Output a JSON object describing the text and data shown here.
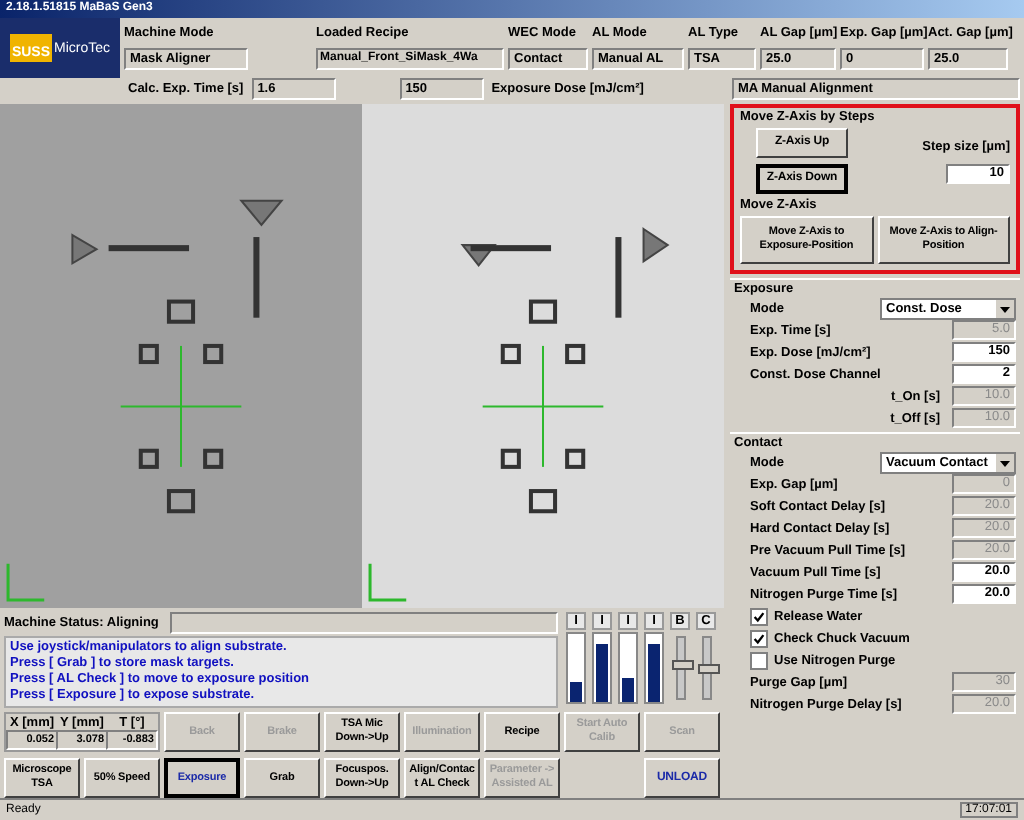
{
  "window": {
    "title": "2.18.1.51815 MaBaS Gen3"
  },
  "logo": {
    "brand": "SUSS",
    "name": "MicroTec"
  },
  "header_fields": [
    {
      "label": "Machine Mode",
      "value": "Mask Aligner"
    },
    {
      "label": "Loaded Recipe",
      "value": "Manual_Front_SiMask_4Wa"
    },
    {
      "label": "WEC Mode",
      "value": "Contact"
    },
    {
      "label": "AL Mode",
      "value": "Manual AL"
    },
    {
      "label": "AL Type",
      "value": "TSA"
    },
    {
      "label": "AL Gap [µm]",
      "value": "25.0"
    },
    {
      "label": "Exp. Gap [µm]",
      "value": "0"
    },
    {
      "label": "Act. Gap [µm]",
      "value": "25.0"
    }
  ],
  "calc": {
    "label": "Calc. Exp. Time [s]",
    "value": "1.6",
    "dose_value": "150",
    "dose_label": "Exposure Dose [mJ/cm²]"
  },
  "mode_title": "MA Manual Alignment",
  "z_steps": {
    "title": "Move Z-Axis by Steps",
    "buttons": [
      {
        "label": "Z-Axis Up",
        "focused": false
      },
      {
        "label": "Z-Axis Down",
        "focused": true
      }
    ],
    "step_label": "Step size  [µm]",
    "step_value": "10"
  },
  "z_move": {
    "title": "Move Z-Axis",
    "buttons": [
      "Move Z-Axis to Exposure-Position",
      "Move Z-Axis to Align-Position"
    ]
  },
  "exposure": {
    "title": "Exposure",
    "items": [
      {
        "kind": "select",
        "label": "Mode",
        "value": "Const. Dose"
      },
      {
        "kind": "input",
        "label": "Exp. Time [s]",
        "value": "5.0",
        "disabled": true
      },
      {
        "kind": "input",
        "label": "Exp. Dose [mJ/cm²]",
        "value": "150",
        "disabled": false
      },
      {
        "kind": "input",
        "label": "Const. Dose Channel",
        "value": "2",
        "disabled": false
      },
      {
        "kind": "sub",
        "label": "t_On [s]",
        "value": "10.0",
        "disabled": true
      },
      {
        "kind": "sub",
        "label": "t_Off [s]",
        "value": "10.0",
        "disabled": true
      }
    ]
  },
  "contact": {
    "title": "Contact",
    "items": [
      {
        "kind": "select",
        "label": "Mode",
        "value": "Vacuum Contact"
      },
      {
        "kind": "input",
        "label": "Exp. Gap [µm]",
        "value": "0",
        "disabled": true
      },
      {
        "kind": "input",
        "label": "Soft Contact Delay [s]",
        "value": "20.0",
        "disabled": true
      },
      {
        "kind": "input",
        "label": "Hard Contact Delay [s]",
        "value": "20.0",
        "disabled": true
      },
      {
        "kind": "input",
        "label": "Pre Vacuum Pull Time [s]",
        "value": "20.0",
        "disabled": true
      },
      {
        "kind": "input",
        "label": "Vacuum Pull Time [s]",
        "value": "20.0",
        "disabled": false
      },
      {
        "kind": "input",
        "label": "Nitrogen Purge Time [s]",
        "value": "20.0",
        "disabled": false
      },
      {
        "kind": "checkbox",
        "label": "Release Water",
        "checked": true
      },
      {
        "kind": "checkbox",
        "label": "Check Chuck Vacuum",
        "checked": true
      },
      {
        "kind": "checkbox",
        "label": "Use Nitrogen Purge",
        "checked": false
      },
      {
        "kind": "input",
        "label": "Purge Gap [µm]",
        "value": "30",
        "disabled": true
      },
      {
        "kind": "input",
        "label": "Nitrogen Purge Delay [s]",
        "value": "20.0",
        "disabled": true
      }
    ]
  },
  "machine_status": "Machine Status: Aligning",
  "messages": [
    "Use joystick/manipulators to align substrate.",
    "Press [ Grab ] to store mask targets.",
    "Press [ AL Check ] to move to exposure position",
    "Press [ Exposure ] to expose substrate."
  ],
  "meters": [
    {
      "kind": "bar",
      "label": "I",
      "level": 0.3
    },
    {
      "kind": "bar",
      "label": "I",
      "level": 0.85
    },
    {
      "kind": "bar",
      "label": "I",
      "level": 0.35
    },
    {
      "kind": "bar",
      "label": "I",
      "level": 0.85
    },
    {
      "kind": "slider",
      "label": "B",
      "level": 0.55
    },
    {
      "kind": "slider",
      "label": "C",
      "level": 0.5
    }
  ],
  "coords": [
    {
      "label": "X [mm]",
      "value": "0.052"
    },
    {
      "label": "Y [mm]",
      "value": "3.078"
    },
    {
      "label": "T [°]",
      "value": "-0.883"
    }
  ],
  "buttons_row1": [
    {
      "label": "Back",
      "disabled": true,
      "focused": false,
      "accent": false
    },
    {
      "label": "Brake",
      "disabled": true,
      "focused": false,
      "accent": false
    },
    {
      "label": "TSA Mic Down->Up",
      "disabled": false,
      "focused": false,
      "accent": false
    },
    {
      "label": "Illumination",
      "disabled": true,
      "focused": false,
      "accent": false
    },
    {
      "label": "Recipe",
      "disabled": false,
      "focused": false,
      "accent": false
    },
    {
      "label": "Start Auto Calib",
      "disabled": true,
      "focused": false,
      "accent": false
    },
    {
      "label": "Scan",
      "disabled": true,
      "focused": false,
      "accent": false
    }
  ],
  "buttons_row2": [
    {
      "label": "Microscope TSA",
      "disabled": false,
      "focused": false,
      "accent": false
    },
    {
      "label": "50% Speed",
      "disabled": false,
      "focused": false,
      "accent": false
    },
    {
      "label": "Exposure",
      "disabled": false,
      "focused": true,
      "accent": true
    },
    {
      "label": "Grab",
      "disabled": false,
      "focused": false,
      "accent": false
    },
    {
      "label": "Focuspos. Down->Up",
      "disabled": false,
      "focused": false,
      "accent": false
    },
    {
      "label": "Align/Contact AL Check",
      "disabled": false,
      "focused": false,
      "accent": false
    },
    {
      "label": "Parameter -> Assisted AL",
      "disabled": true,
      "focused": false,
      "accent": false
    }
  ],
  "unload_button": {
    "label": "UNLOAD",
    "accent": true
  },
  "status_bar": {
    "text": "Ready",
    "time": "17:07:01"
  }
}
